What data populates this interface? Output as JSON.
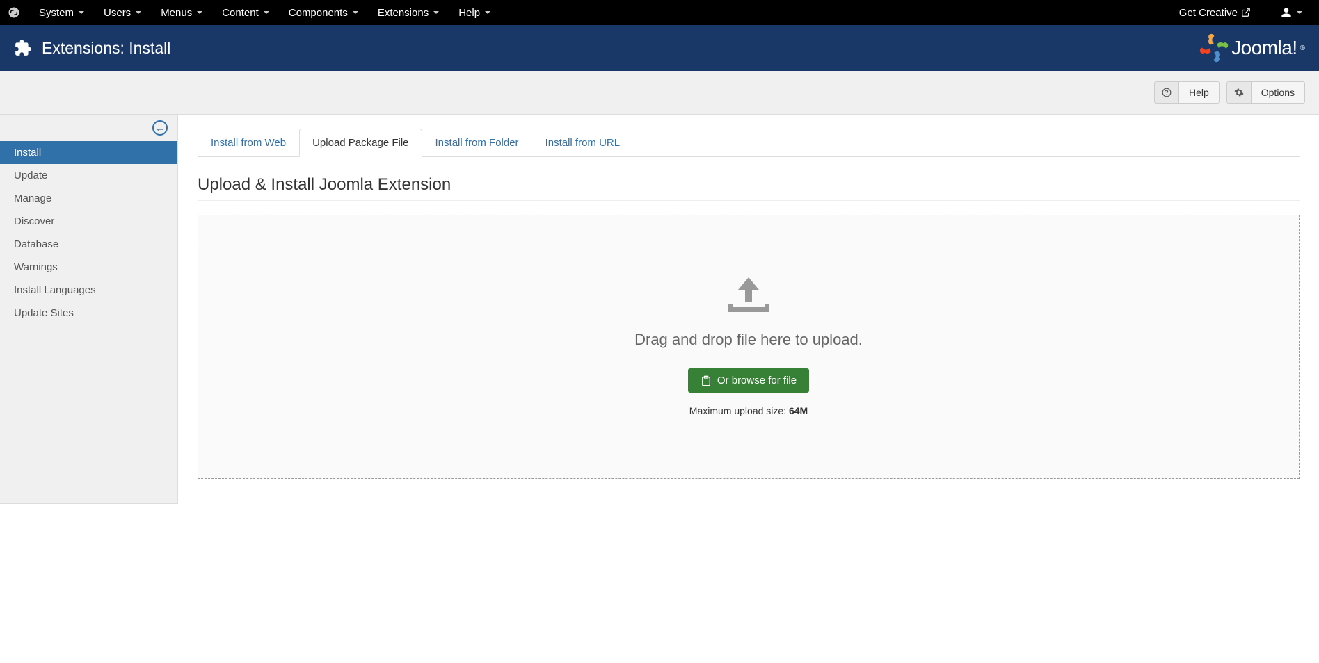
{
  "topbar": {
    "menus": [
      "System",
      "Users",
      "Menus",
      "Content",
      "Components",
      "Extensions",
      "Help"
    ],
    "site_name": "Get Creative"
  },
  "header": {
    "title": "Extensions: Install",
    "brand": "Joomla!"
  },
  "toolbar": {
    "help_label": "Help",
    "options_label": "Options"
  },
  "sidebar": {
    "items": [
      "Install",
      "Update",
      "Manage",
      "Discover",
      "Database",
      "Warnings",
      "Install Languages",
      "Update Sites"
    ],
    "active_index": 0
  },
  "tabs": {
    "items": [
      "Install from Web",
      "Upload Package File",
      "Install from Folder",
      "Install from URL"
    ],
    "active_index": 1
  },
  "section": {
    "title": "Upload & Install Joomla Extension",
    "drop_text": "Drag and drop file here to upload.",
    "browse_label": "Or browse for file",
    "max_size_label": "Maximum upload size: ",
    "max_size_value": "64M"
  }
}
